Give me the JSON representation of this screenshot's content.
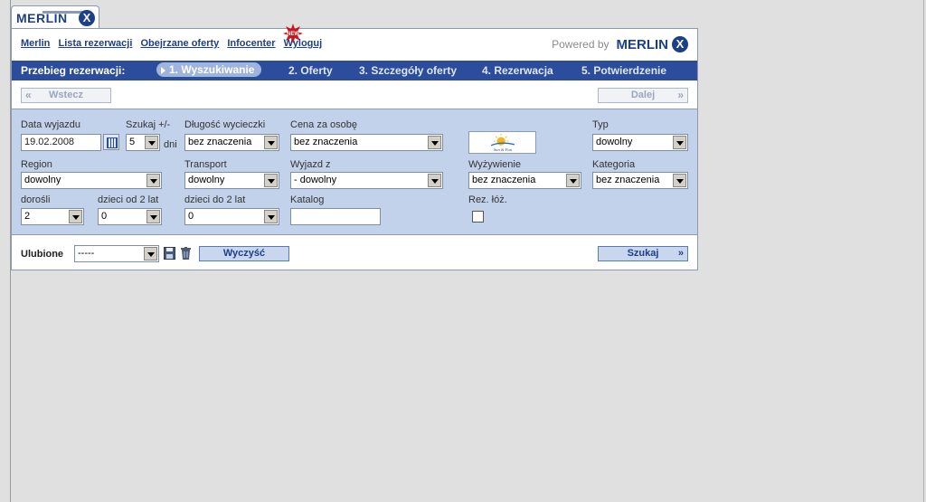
{
  "logo": {
    "text": "MERLIN",
    "mark": "X"
  },
  "topnav": {
    "links": [
      "Merlin",
      "Lista rezerwacji",
      "Obejrzane oferty",
      "Infocenter",
      "Wyloguj"
    ],
    "new_badge": "NEW",
    "powered_by": "Powered by",
    "brand": "MERLIN",
    "brand_mark": "X"
  },
  "steps": {
    "label": "Przebieg rezerwacji:",
    "items": [
      "1. Wyszukiwanie",
      "2. Oferty",
      "3. Szczegóły oferty",
      "4. Rezerwacja",
      "5. Potwierdzenie"
    ],
    "active_index": 0
  },
  "nav": {
    "back": "Wstecz",
    "next": "Dalej"
  },
  "form": {
    "departure_date": {
      "label": "Data wyjazdu",
      "value": "19.02.2008"
    },
    "search_range": {
      "label": "Szukaj +/-",
      "value": "5",
      "unit": "dni"
    },
    "trip_length": {
      "label": "Długość wycieczki",
      "value": "bez znaczenia"
    },
    "price": {
      "label": "Cena za osobę",
      "value": "bez znaczenia"
    },
    "type": {
      "label": "Typ",
      "value": "dowolny"
    },
    "region": {
      "label": "Region",
      "value": "dowolny"
    },
    "transport": {
      "label": "Transport",
      "value": "dowolny"
    },
    "departure_from": {
      "label": "Wyjazd z",
      "value": "- dowolny"
    },
    "board": {
      "label": "Wyżywienie",
      "value": "bez znaczenia"
    },
    "category": {
      "label": "Kategoria",
      "value": "bez znaczenia"
    },
    "adults": {
      "label": "dorośli",
      "value": "2"
    },
    "children_over2": {
      "label": "dzieci od 2 lat",
      "value": "0"
    },
    "children_under2": {
      "label": "dzieci do 2 lat",
      "value": "0"
    },
    "catalog": {
      "label": "Katalog",
      "value": ""
    },
    "rez_loz": {
      "label": "Rez. łóż.",
      "checked": false
    },
    "sun_logo": "Sun & Fun"
  },
  "bottom": {
    "favorites_label": "Ulubione",
    "favorites_value": "-----",
    "clear_button": "Wyczyść",
    "search_button": "Szukaj"
  },
  "colors": {
    "accent": "#2b4d9c",
    "form_bg": "#c2d2ea",
    "page_bg": "#e0e0e0"
  }
}
